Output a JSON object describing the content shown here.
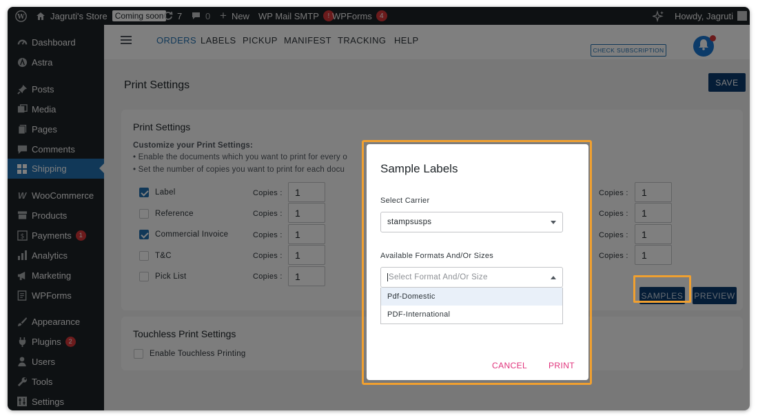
{
  "admin_bar": {
    "site_name": "Jagruti's Store",
    "coming_soon": "Coming soon",
    "updates_count": "7",
    "comments_count": "0",
    "new_label": "New",
    "wp_mail_smtp": "WP Mail SMTP",
    "wp_mail_smtp_badge": "!",
    "wpforms": "WPForms",
    "wpforms_badge": "4",
    "greeting": "Howdy, Jagruti"
  },
  "sidebar": {
    "items": [
      {
        "label": "Dashboard",
        "icon": "dashboard-icon"
      },
      {
        "label": "Astra",
        "icon": "astra-icon"
      },
      {
        "label": "Posts",
        "icon": "pin-icon"
      },
      {
        "label": "Media",
        "icon": "media-icon"
      },
      {
        "label": "Pages",
        "icon": "pages-icon"
      },
      {
        "label": "Comments",
        "icon": "comment-icon"
      },
      {
        "label": "Shipping",
        "icon": "grid-icon",
        "active": true
      },
      {
        "label": "WooCommerce",
        "icon": "woo-icon"
      },
      {
        "label": "Products",
        "icon": "archive-icon"
      },
      {
        "label": "Payments",
        "icon": "dollar-icon",
        "badge": "1"
      },
      {
        "label": "Analytics",
        "icon": "bar-chart-icon"
      },
      {
        "label": "Marketing",
        "icon": "megaphone-icon"
      },
      {
        "label": "WPForms",
        "icon": "form-icon"
      },
      {
        "label": "Appearance",
        "icon": "brush-icon"
      },
      {
        "label": "Plugins",
        "icon": "plug-icon",
        "badge": "2"
      },
      {
        "label": "Users",
        "icon": "user-icon"
      },
      {
        "label": "Tools",
        "icon": "wrench-icon"
      },
      {
        "label": "Settings",
        "icon": "settings-icon"
      }
    ]
  },
  "topnav": {
    "tabs": [
      "ORDERS",
      "LABELS",
      "PICKUP",
      "MANIFEST",
      "TRACKING",
      "HELP"
    ],
    "active_tab": "ORDERS",
    "check_subscription": "CHECK SUBSCRIPTION"
  },
  "page": {
    "title": "Print Settings",
    "save_label": "SAVE"
  },
  "print_settings": {
    "title": "Print Settings",
    "customize_heading": "Customize your Print Settings:",
    "bullet_1": "• Enable the documents which you want to print for every o",
    "bullet_2": "• Set the number of copies you want to print for each docu",
    "copies_label": "Copies :",
    "documents": [
      {
        "label": "Label",
        "checked": true,
        "copies": "1"
      },
      {
        "label": "Reference",
        "checked": false,
        "copies": "1"
      },
      {
        "label": "Commercial Invoice",
        "checked": true,
        "copies": "1"
      },
      {
        "label": "T&C",
        "checked": false,
        "copies": "1"
      },
      {
        "label": "Pick List",
        "checked": false,
        "copies": "1"
      }
    ],
    "right_copies": [
      "1",
      "1",
      "1",
      "1"
    ],
    "samples_label": "SAMPLES",
    "preview_label": "PREVIEW"
  },
  "touchless": {
    "title": "Touchless Print Settings",
    "checkbox_label": "Enable Touchless Printing"
  },
  "modal": {
    "title": "Sample Labels",
    "carrier_label": "Select Carrier",
    "carrier_value": "stampsusps",
    "formats_label": "Available Formats And/Or Sizes",
    "formats_placeholder": "Select Format And/Or Size",
    "options": [
      "Pdf-Domestic",
      "PDF-International"
    ],
    "cancel_label": "CANCEL",
    "print_label": "PRINT"
  },
  "colors": {
    "admin_bar_bg": "#1d2327",
    "active_menu": "#2271b1",
    "primary_button": "#0b3a6e",
    "highlight": "#f0a030",
    "action_pink": "#e0327b"
  }
}
